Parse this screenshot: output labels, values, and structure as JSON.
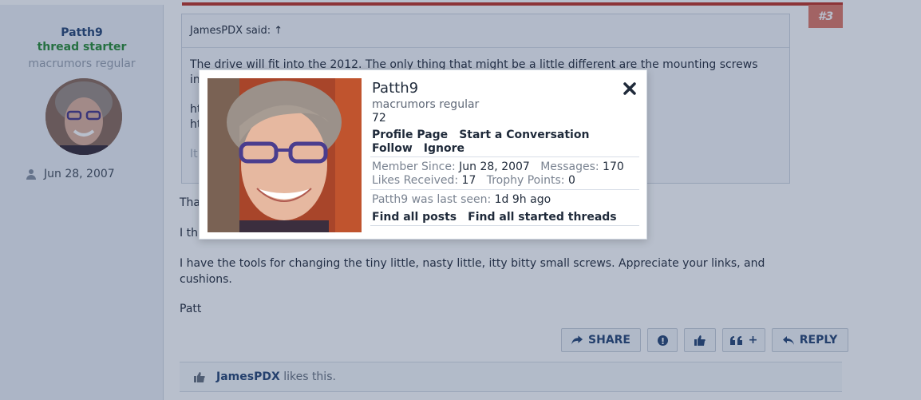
{
  "post": {
    "number": "#3",
    "author": {
      "name": "Patth9",
      "badge": "thread starter",
      "title": "macrumors regular",
      "join_date": "Jun 28, 2007"
    },
    "quote": {
      "attribution": "JamesPDX said: ↑",
      "lines": [
        "The drive will fit into the 2012. The only thing that might be a little different are the mounting screws",
        "in                                                                                                                                                   these for tutorials:",
        "ht                                                                                                                                                       113",
        "ht                                                                                                                                                       1716"
      ],
      "faded_line": "It                                                                                                                                    take your time. You"
    },
    "message": {
      "line1": "Tha",
      "line2": "I th                                                                                                                                                re not the same.",
      "line3": "I have the tools for changing the tiny little, nasty little, itty bitty small screws. Appreciate your links, and",
      "line4": "cushions.",
      "signature": "Patt"
    },
    "actions": {
      "share": "SHARE",
      "quote_plus": "+",
      "reply": "REPLY"
    },
    "likes": {
      "user": "JamesPDX",
      "text": " likes this."
    }
  },
  "popup": {
    "name": "Patth9",
    "title": "macrumors regular",
    "count": "72",
    "links": {
      "profile": "Profile Page",
      "conversation": "Start a Conversation",
      "follow": "Follow",
      "ignore": "Ignore"
    },
    "stats": {
      "member_since_label": "Member Since:",
      "member_since": "Jun 28, 2007",
      "messages_label": "Messages:",
      "messages": "170",
      "likes_label": "Likes Received:",
      "likes": "17",
      "trophy_label": "Trophy Points:",
      "trophy": "0",
      "last_seen_label": "Patth9 was last seen:",
      "last_seen": "1d 9h ago"
    },
    "find": {
      "posts": "Find all posts",
      "threads": "Find all started threads"
    }
  },
  "colors": {
    "accent": "#2b4a78",
    "starter": "#2f8f3a",
    "post_number": "#e07b6a",
    "top_bar": "#c0392b"
  }
}
